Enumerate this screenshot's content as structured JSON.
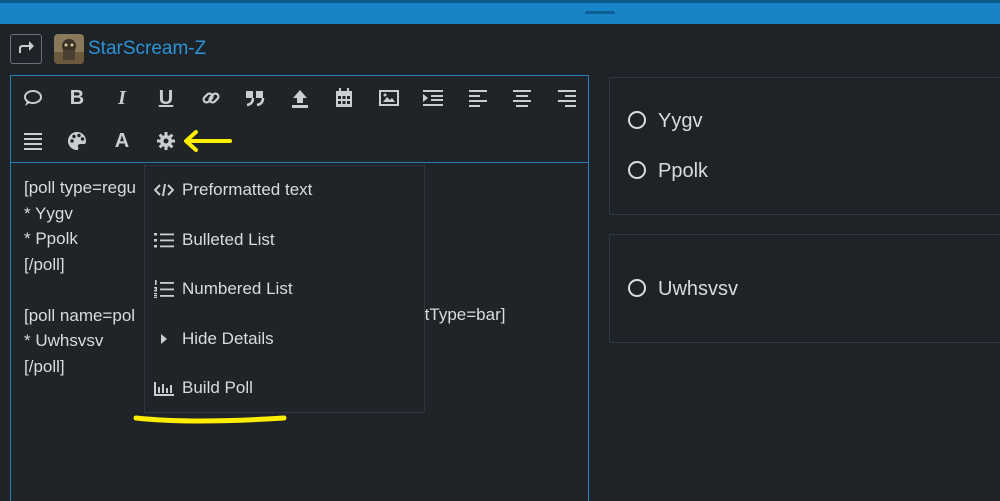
{
  "header": {
    "username": "StarScream-Z"
  },
  "toolbar": {
    "icons": [
      "speech-bubble-icon",
      "bold-icon",
      "italic-icon",
      "underline-icon",
      "link-icon",
      "blockquote-icon",
      "upload-icon",
      "calendar-icon",
      "image-icon",
      "indent-icon",
      "align-left-icon",
      "align-center-icon",
      "align-right-icon",
      "justify-icon",
      "palette-icon",
      "font-icon",
      "gear-icon"
    ],
    "bold_label": "B",
    "italic_label": "I",
    "underline_label": "U",
    "font_label": "A"
  },
  "editor": {
    "lines": [
      "[poll type=regu",
      "* Yygv",
      "* Ppolk",
      "[/poll]",
      "",
      "[poll name=pol",
      "* Uwhsvsv",
      "[/poll]"
    ],
    "hidden_tail": "rtType=bar]"
  },
  "menu": {
    "items": [
      {
        "label": "Preformatted text",
        "icon": "code-icon"
      },
      {
        "label": "Bulleted List",
        "icon": "bulleted-list-icon"
      },
      {
        "label": "Numbered List",
        "icon": "numbered-list-icon"
      },
      {
        "label": "Hide Details",
        "icon": "caret-right-icon"
      },
      {
        "label": "Build Poll",
        "icon": "bar-chart-icon"
      }
    ]
  },
  "preview": {
    "poll1": {
      "options": [
        "Yygv",
        "Ppolk"
      ]
    },
    "poll2": {
      "options": [
        "Uwhsvsv"
      ]
    }
  },
  "colors": {
    "accent": "#1784c7",
    "username": "#2b93d6",
    "annotation": "#ffee00",
    "background": "#1e2328"
  }
}
